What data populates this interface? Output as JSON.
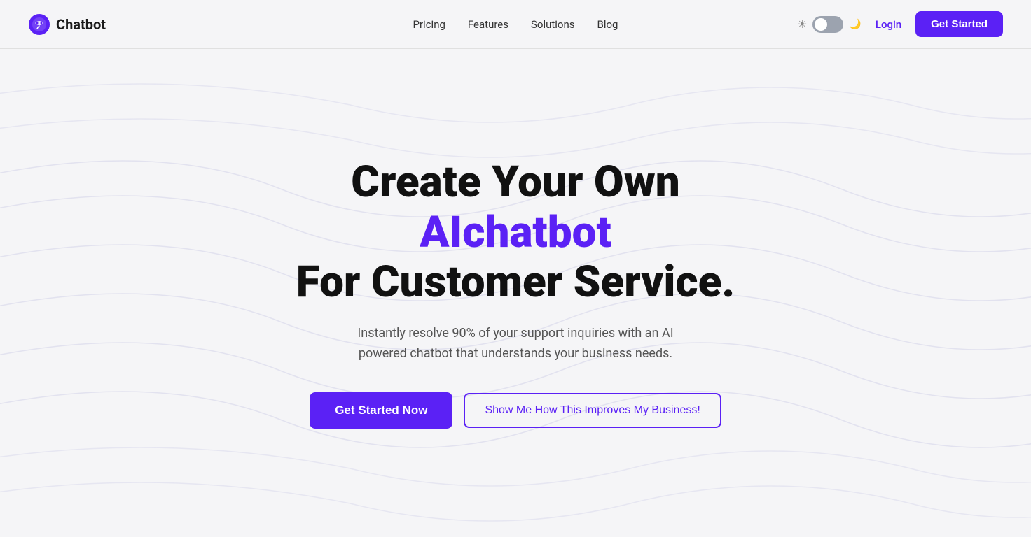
{
  "navbar": {
    "logo_text": "Chatbot",
    "nav_links": [
      {
        "label": "Pricing",
        "id": "pricing"
      },
      {
        "label": "Features",
        "id": "features"
      },
      {
        "label": "Solutions",
        "id": "solutions"
      },
      {
        "label": "Blog",
        "id": "blog"
      }
    ],
    "login_label": "Login",
    "get_started_label": "Get Started",
    "toggle_aria": "Toggle dark mode"
  },
  "hero": {
    "title_prefix": "Create Your Own ",
    "title_highlight": "AIchatbot",
    "title_suffix": "For Customer Service.",
    "subtitle": "Instantly resolve 90% of your support inquiries with an AI powered chatbot that understands your business needs.",
    "cta_primary": "Get Started Now",
    "cta_secondary": "Show Me How This Improves My Business!",
    "accent_color": "#5b21f5"
  }
}
